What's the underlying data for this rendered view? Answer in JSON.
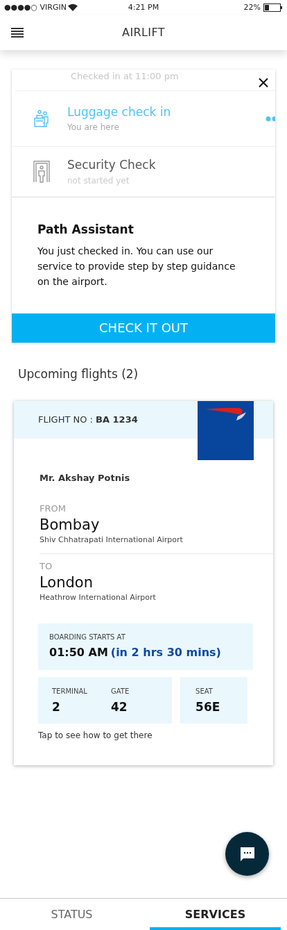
{
  "status_bar": {
    "carrier": "●●●●○ VIRGIN",
    "time": "4:21 PM",
    "battery": "22%"
  },
  "header": {
    "title": "AIRLIFT"
  },
  "steps": [
    {
      "kind": "done",
      "title": "Checked in at 11:00 pm"
    },
    {
      "kind": "current",
      "title": "Luggage check in",
      "subtitle": "You are here"
    },
    {
      "kind": "pending",
      "title": "Security Check",
      "subtitle": "not started yet"
    }
  ],
  "assistant": {
    "title": "Path Assistant",
    "body": "You just checked in. You can use our service to provide step by step guidance on the airport.",
    "button": "CHECK IT OUT"
  },
  "upcoming": {
    "title": "Upcoming flights (2)"
  },
  "flight": {
    "number_label": "FLIGHT NO : ",
    "number": "BA 1234",
    "passenger": "Mr. Akshay Potnis",
    "from": {
      "label": "FROM",
      "city": "Bombay",
      "airport": "Shiv Chhatrapati International Airport"
    },
    "to": {
      "label": "TO",
      "city": "London",
      "airport": "Heathrow International Airport"
    },
    "boarding": {
      "label": "BOARDING STARTS AT",
      "time": "01:50 AM",
      "countdown": "(in 2 hrs 30 mins)"
    },
    "terminal": {
      "label": "TERMINAL",
      "value": "2"
    },
    "gate": {
      "label": "GATE",
      "value": "42"
    },
    "seat": {
      "label": "SEAT",
      "value": "56E"
    },
    "hint": "Tap to see how to get there"
  },
  "tabs": [
    {
      "label": "STATUS",
      "selected": false
    },
    {
      "label": "SERVICES",
      "selected": true
    }
  ]
}
